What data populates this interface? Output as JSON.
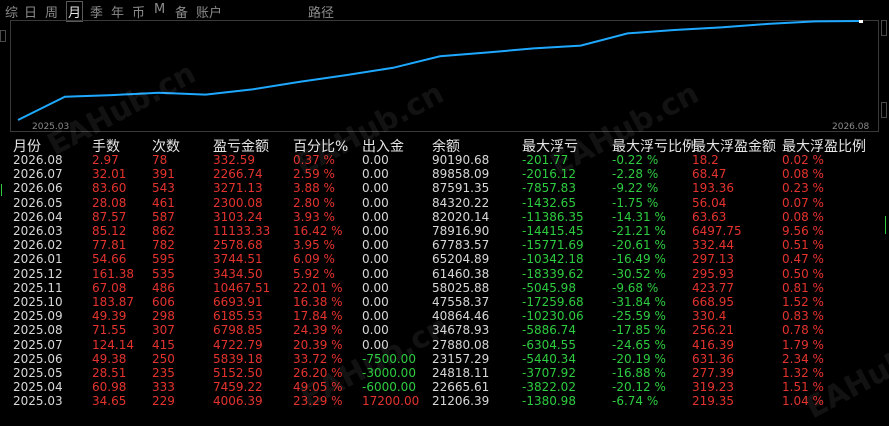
{
  "tabs": [
    "综",
    "日",
    "周",
    "月",
    "季",
    "年",
    "币",
    "M",
    "备",
    "账户"
  ],
  "active_tab": "月",
  "path_label": "路径",
  "chart": {
    "x_start": "2025.03",
    "x_end": "2026.08",
    "line_color": "#1ea8ff"
  },
  "watermark": "EAHub.cn",
  "table": {
    "headers": [
      "月份",
      "手数",
      "次数",
      "盈亏金额",
      "百分比%",
      "出入金",
      "余额",
      "最大浮亏",
      "最大浮亏比例",
      "最大浮盈金额",
      "最大浮盈比例"
    ],
    "rows": [
      {
        "month": "2026.08",
        "lots": "2.97",
        "trades": "78",
        "pnl": "332.59",
        "pct": "0.37 %",
        "flow": "0.00",
        "balance": "90190.68",
        "maxloss": "-201.77",
        "maxloss_pct": "-0.22 %",
        "maxgain": "18.2",
        "maxgain_pct": "0.02 %"
      },
      {
        "month": "2026.07",
        "lots": "32.01",
        "trades": "391",
        "pnl": "2266.74",
        "pct": "2.59 %",
        "flow": "0.00",
        "balance": "89858.09",
        "maxloss": "-2016.12",
        "maxloss_pct": "-2.28 %",
        "maxgain": "68.47",
        "maxgain_pct": "0.08 %"
      },
      {
        "month": "2026.06",
        "lots": "83.60",
        "trades": "543",
        "pnl": "3271.13",
        "pct": "3.88 %",
        "flow": "0.00",
        "balance": "87591.35",
        "maxloss": "-7857.83",
        "maxloss_pct": "-9.22 %",
        "maxgain": "193.36",
        "maxgain_pct": "0.23 %"
      },
      {
        "month": "2026.05",
        "lots": "28.08",
        "trades": "461",
        "pnl": "2300.08",
        "pct": "2.80 %",
        "flow": "0.00",
        "balance": "84320.22",
        "maxloss": "-1432.65",
        "maxloss_pct": "-1.75 %",
        "maxgain": "56.04",
        "maxgain_pct": "0.07 %"
      },
      {
        "month": "2026.04",
        "lots": "87.57",
        "trades": "587",
        "pnl": "3103.24",
        "pct": "3.93 %",
        "flow": "0.00",
        "balance": "82020.14",
        "maxloss": "-11386.35",
        "maxloss_pct": "-14.31 %",
        "maxgain": "63.63",
        "maxgain_pct": "0.08 %"
      },
      {
        "month": "2026.03",
        "lots": "85.12",
        "trades": "862",
        "pnl": "11133.33",
        "pct": "16.42 %",
        "flow": "0.00",
        "balance": "78916.90",
        "maxloss": "-14415.45",
        "maxloss_pct": "-21.21 %",
        "maxgain": "6497.75",
        "maxgain_pct": "9.56 %"
      },
      {
        "month": "2026.02",
        "lots": "77.81",
        "trades": "782",
        "pnl": "2578.68",
        "pct": "3.95 %",
        "flow": "0.00",
        "balance": "67783.57",
        "maxloss": "-15771.69",
        "maxloss_pct": "-20.61 %",
        "maxgain": "332.44",
        "maxgain_pct": "0.51 %"
      },
      {
        "month": "2026.01",
        "lots": "54.66",
        "trades": "595",
        "pnl": "3744.51",
        "pct": "6.09 %",
        "flow": "0.00",
        "balance": "65204.89",
        "maxloss": "-10342.18",
        "maxloss_pct": "-16.49 %",
        "maxgain": "297.13",
        "maxgain_pct": "0.47 %"
      },
      {
        "month": "2025.12",
        "lots": "161.38",
        "trades": "535",
        "pnl": "3434.50",
        "pct": "5.92 %",
        "flow": "0.00",
        "balance": "61460.38",
        "maxloss": "-18339.62",
        "maxloss_pct": "-30.52 %",
        "maxgain": "295.93",
        "maxgain_pct": "0.50 %"
      },
      {
        "month": "2025.11",
        "lots": "67.08",
        "trades": "486",
        "pnl": "10467.51",
        "pct": "22.01 %",
        "flow": "0.00",
        "balance": "58025.88",
        "maxloss": "-5045.98",
        "maxloss_pct": "-9.68 %",
        "maxgain": "423.77",
        "maxgain_pct": "0.81 %"
      },
      {
        "month": "2025.10",
        "lots": "183.87",
        "trades": "606",
        "pnl": "6693.91",
        "pct": "16.38 %",
        "flow": "0.00",
        "balance": "47558.37",
        "maxloss": "-17259.68",
        "maxloss_pct": "-31.84 %",
        "maxgain": "668.95",
        "maxgain_pct": "1.52 %"
      },
      {
        "month": "2025.09",
        "lots": "49.39",
        "trades": "298",
        "pnl": "6185.53",
        "pct": "17.84 %",
        "flow": "0.00",
        "balance": "40864.46",
        "maxloss": "-10230.06",
        "maxloss_pct": "-25.59 %",
        "maxgain": "330.4",
        "maxgain_pct": "0.83 %"
      },
      {
        "month": "2025.08",
        "lots": "71.55",
        "trades": "307",
        "pnl": "6798.85",
        "pct": "24.39 %",
        "flow": "0.00",
        "balance": "34678.93",
        "maxloss": "-5886.74",
        "maxloss_pct": "-17.85 %",
        "maxgain": "256.21",
        "maxgain_pct": "0.78 %"
      },
      {
        "month": "2025.07",
        "lots": "124.14",
        "trades": "415",
        "pnl": "4722.79",
        "pct": "20.39 %",
        "flow": "0.00",
        "balance": "27880.08",
        "maxloss": "-6304.55",
        "maxloss_pct": "-24.65 %",
        "maxgain": "416.39",
        "maxgain_pct": "1.79 %"
      },
      {
        "month": "2025.06",
        "lots": "49.38",
        "trades": "250",
        "pnl": "5839.18",
        "pct": "33.72 %",
        "flow": "-7500.00",
        "balance": "23157.29",
        "maxloss": "-5440.34",
        "maxloss_pct": "-20.19 %",
        "maxgain": "631.36",
        "maxgain_pct": "2.34 %"
      },
      {
        "month": "2025.05",
        "lots": "28.51",
        "trades": "235",
        "pnl": "5152.50",
        "pct": "26.20 %",
        "flow": "-3000.00",
        "balance": "24818.11",
        "maxloss": "-3707.92",
        "maxloss_pct": "-16.88 %",
        "maxgain": "277.39",
        "maxgain_pct": "1.32 %"
      },
      {
        "month": "2025.04",
        "lots": "60.98",
        "trades": "333",
        "pnl": "7459.22",
        "pct": "49.05 %",
        "flow": "-6000.00",
        "balance": "22665.61",
        "maxloss": "-3822.02",
        "maxloss_pct": "-20.12 %",
        "maxgain": "319.23",
        "maxgain_pct": "1.51 %"
      },
      {
        "month": "2025.03",
        "lots": "34.65",
        "trades": "229",
        "pnl": "4006.39",
        "pct": "23.29 %",
        "flow": "17200.00",
        "balance": "21206.39",
        "maxloss": "-1380.98",
        "maxloss_pct": "-6.74 %",
        "maxgain": "219.35",
        "maxgain_pct": "1.04 %"
      }
    ]
  }
}
